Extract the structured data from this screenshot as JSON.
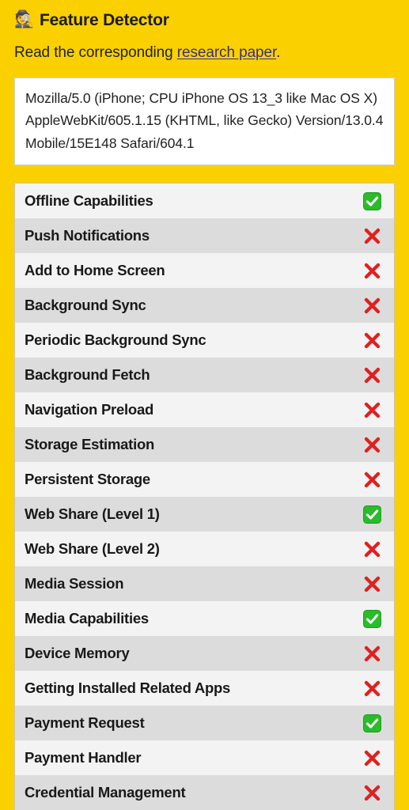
{
  "header": {
    "icon": "detective-emoji",
    "icon_glyph": "🕵️",
    "title": "Feature Detector"
  },
  "intro": {
    "prefix": "Read the corresponding ",
    "link_text": "research paper",
    "suffix": "."
  },
  "user_agent": {
    "value": "Mozilla/5.0 (iPhone; CPU iPhone OS 13_3 like Mac OS X) AppleWebKit/605.1.15 (KHTML, like Gecko) Version/13.0.4 Mobile/15E148 Safari/604.1"
  },
  "colors": {
    "background": "#FBD000",
    "row_light": "#F3F3F3",
    "row_dark": "#DCDCDC",
    "supported": "#2ABC2A",
    "unsupported": "#E02020",
    "link": "#3B2F7A"
  },
  "features": [
    {
      "label": "Offline Capabilities",
      "supported": true
    },
    {
      "label": "Push Notifications",
      "supported": false
    },
    {
      "label": "Add to Home Screen",
      "supported": false
    },
    {
      "label": "Background Sync",
      "supported": false
    },
    {
      "label": "Periodic Background Sync",
      "supported": false
    },
    {
      "label": "Background Fetch",
      "supported": false
    },
    {
      "label": "Navigation Preload",
      "supported": false
    },
    {
      "label": "Storage Estimation",
      "supported": false
    },
    {
      "label": "Persistent Storage",
      "supported": false
    },
    {
      "label": "Web Share (Level 1)",
      "supported": true
    },
    {
      "label": "Web Share (Level 2)",
      "supported": false
    },
    {
      "label": "Media Session",
      "supported": false
    },
    {
      "label": "Media Capabilities",
      "supported": true
    },
    {
      "label": "Device Memory",
      "supported": false
    },
    {
      "label": "Getting Installed Related Apps",
      "supported": false
    },
    {
      "label": "Payment Request",
      "supported": true
    },
    {
      "label": "Payment Handler",
      "supported": false
    },
    {
      "label": "Credential Management",
      "supported": false
    }
  ]
}
